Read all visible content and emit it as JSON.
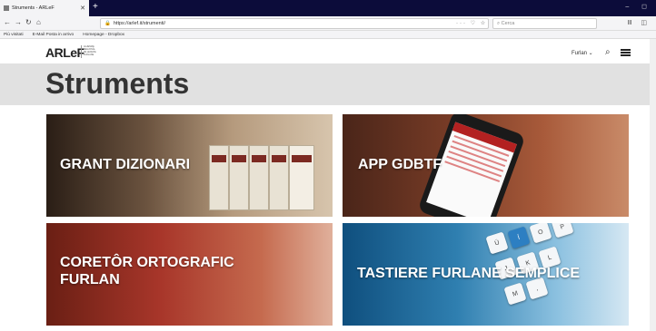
{
  "browser": {
    "tab_title": "Struments - ARLeF",
    "new_tab": "+",
    "url": "https://arlef.it/strumenti/",
    "search_placeholder": "Cerca",
    "bookmarks": [
      "Più visitati",
      "E-Mail Posta in arrivo",
      "Homepage - Dropbox"
    ]
  },
  "site": {
    "logo": "ARLeF",
    "logo_sub": "AGJENZIE REGJONÂL PE LENGHE FURLANE",
    "language": "Furlan ⌄"
  },
  "page": {
    "title": "Struments"
  },
  "cards": [
    {
      "label": "GRANT DIZIONARI"
    },
    {
      "label": "APP GDBTF"
    },
    {
      "label_line1": "CORETÔR ORTOGRAFIC",
      "label_line2": "FURLAN"
    },
    {
      "label": "TASTIERE FURLANE SEMPLICE"
    }
  ]
}
